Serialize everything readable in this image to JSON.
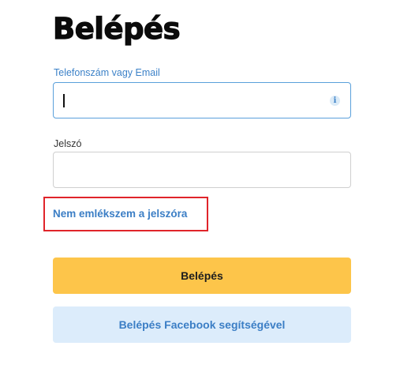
{
  "form": {
    "title": "Belépés",
    "login_field": {
      "label": "Telefonszám vagy Email",
      "value": "",
      "placeholder": "",
      "info_icon": "info-icon"
    },
    "password_field": {
      "label": "Jelszó",
      "value": "",
      "placeholder": ""
    },
    "forgot_password_link": "Nem emlékszem a jelszóra",
    "login_button": "Belépés",
    "facebook_button": "Belépés Facebook segítségével"
  },
  "colors": {
    "accent_blue": "#3d82c8",
    "login_button_bg": "#fdc54a",
    "facebook_button_bg": "#dcecfb",
    "highlight_border": "#e0242a"
  }
}
